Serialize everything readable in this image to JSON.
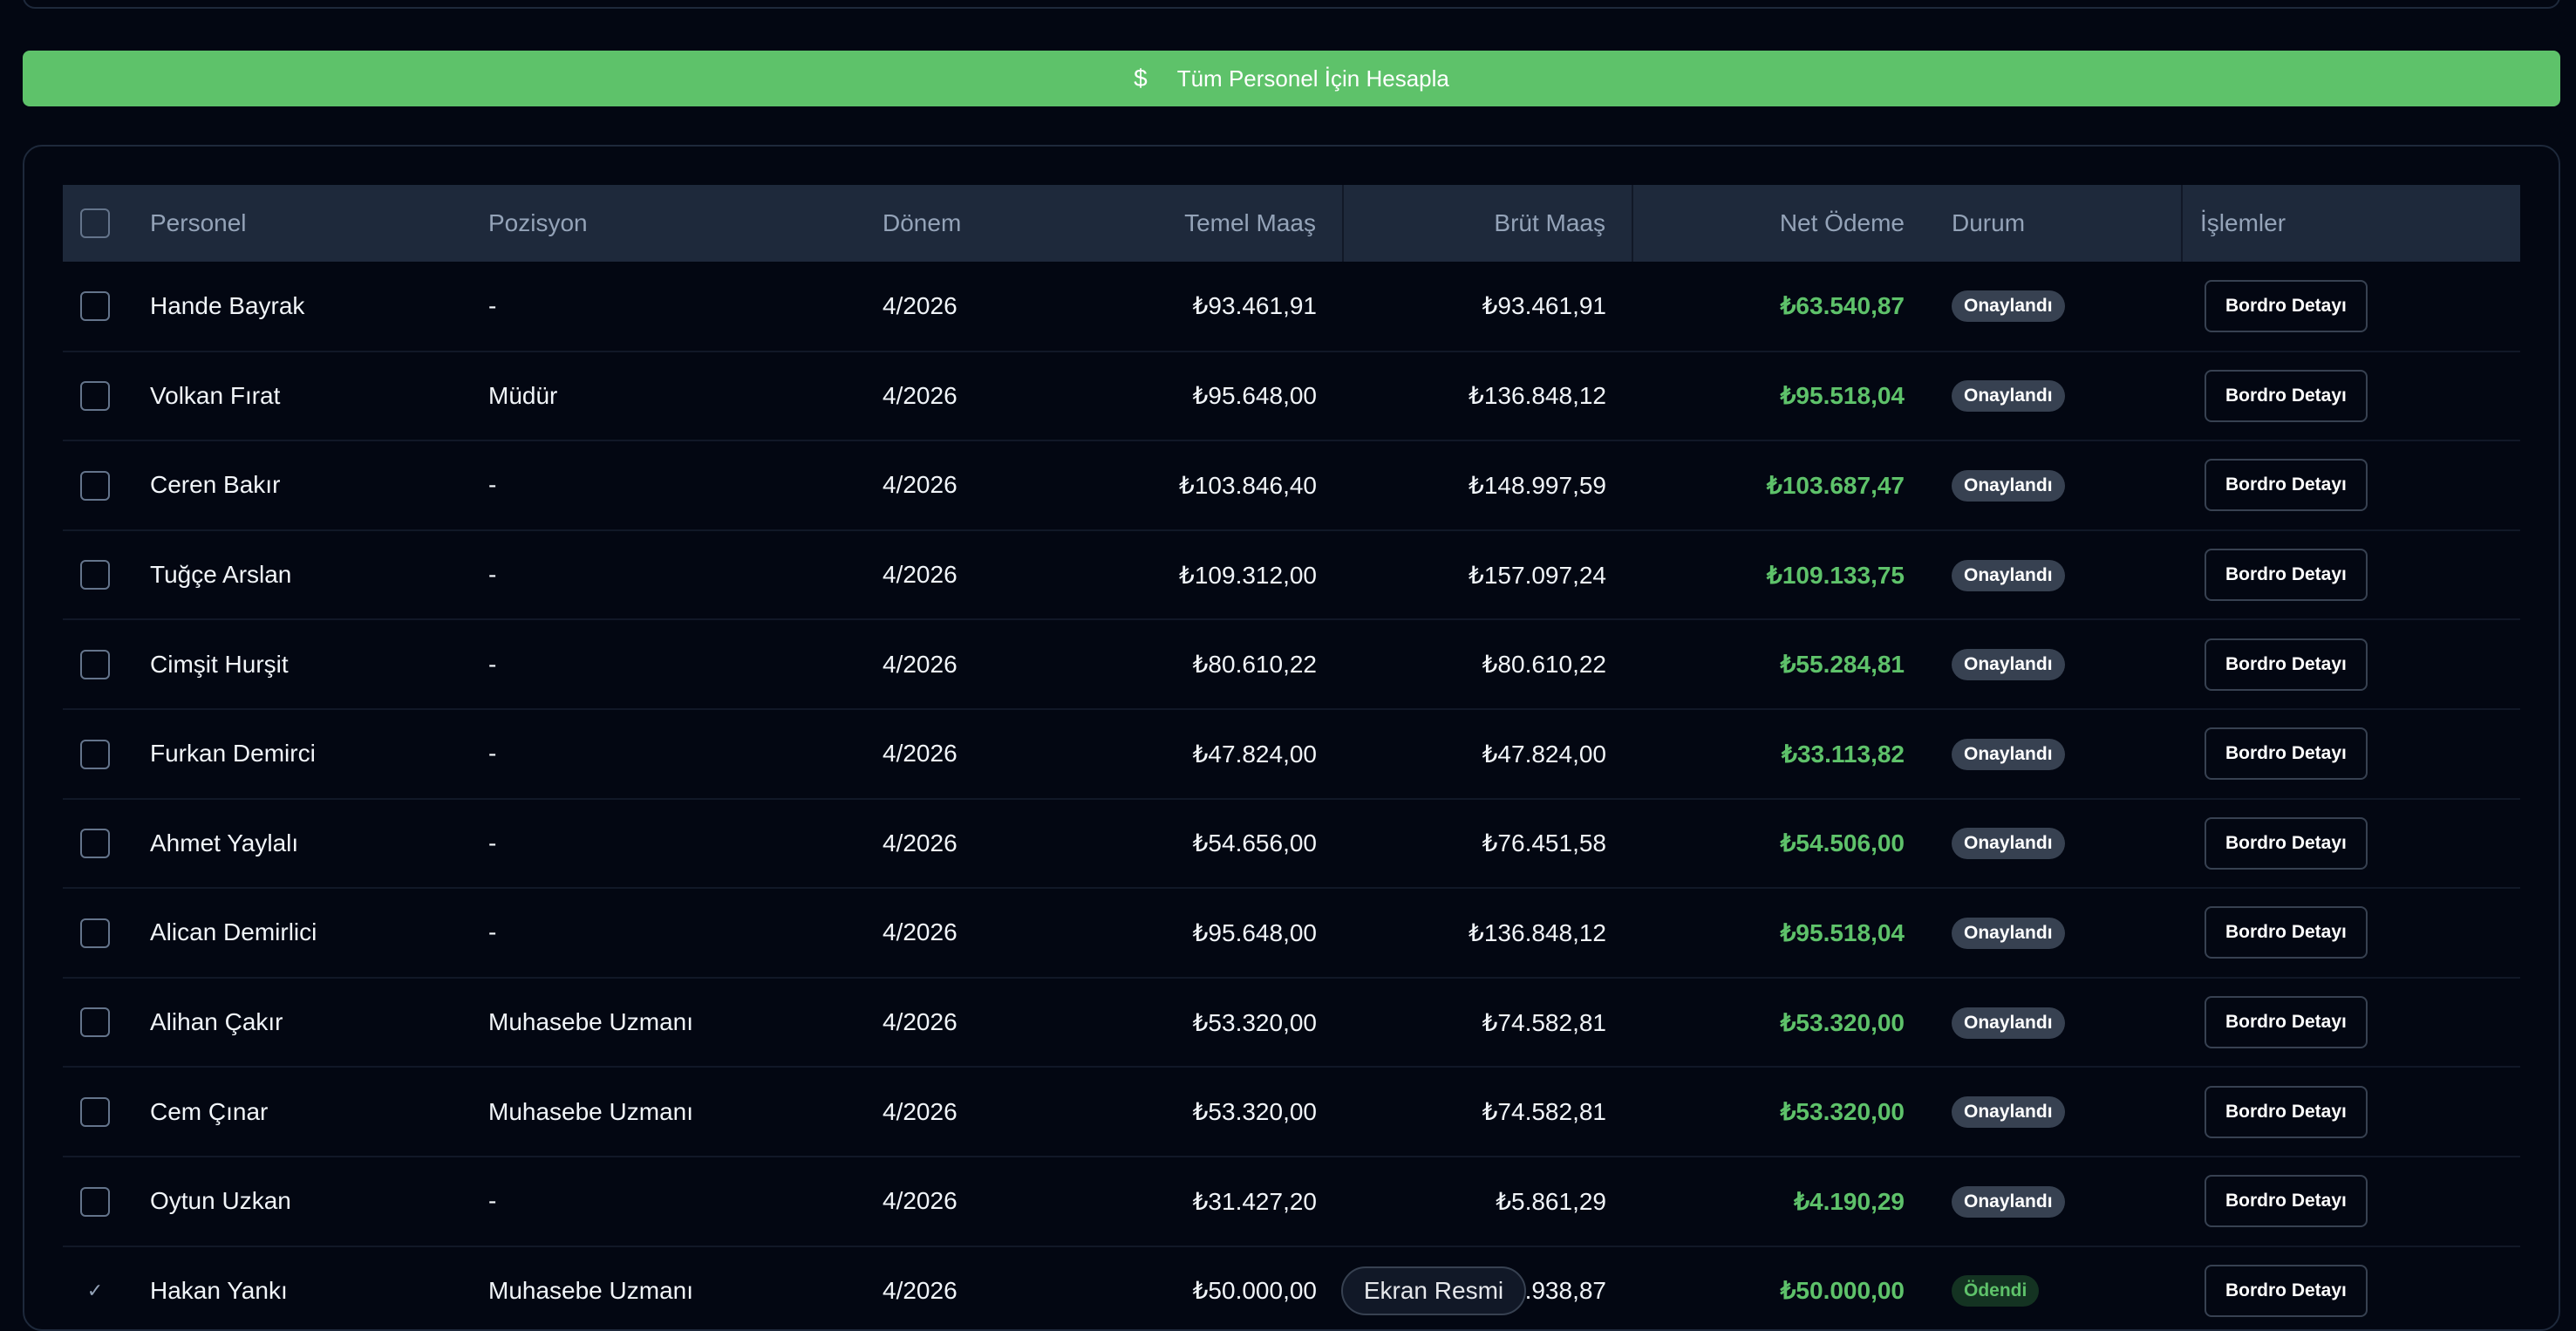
{
  "calc_button": {
    "label": "Tüm Personel İçin Hesapla",
    "icon": "dollar-icon"
  },
  "colors": {
    "accent_green": "#5ec26a",
    "background": "#030712",
    "header_bg": "#1e293b"
  },
  "table": {
    "headers": {
      "personnel": "Personel",
      "position": "Pozisyon",
      "period": "Dönem",
      "base_salary": "Temel Maaş",
      "gross_salary": "Brüt Maaş",
      "net_payment": "Net Ödeme",
      "status": "Durum",
      "actions": "İşlemler"
    },
    "rows": [
      {
        "name": "Hande Bayrak",
        "position": "-",
        "period": "4/2026",
        "base": "₺93.461,91",
        "gross": "₺93.461,91",
        "net": "₺63.540,87",
        "status": "Onaylandı",
        "action": "Bordro Detayı",
        "checked": false
      },
      {
        "name": "Volkan Fırat",
        "position": "Müdür",
        "period": "4/2026",
        "base": "₺95.648,00",
        "gross": "₺136.848,12",
        "net": "₺95.518,04",
        "status": "Onaylandı",
        "action": "Bordro Detayı",
        "checked": false
      },
      {
        "name": "Ceren Bakır",
        "position": "-",
        "period": "4/2026",
        "base": "₺103.846,40",
        "gross": "₺148.997,59",
        "net": "₺103.687,47",
        "status": "Onaylandı",
        "action": "Bordro Detayı",
        "checked": false
      },
      {
        "name": "Tuğçe Arslan",
        "position": "-",
        "period": "4/2026",
        "base": "₺109.312,00",
        "gross": "₺157.097,24",
        "net": "₺109.133,75",
        "status": "Onaylandı",
        "action": "Bordro Detayı",
        "checked": false
      },
      {
        "name": "Cimşit Hurşit",
        "position": "-",
        "period": "4/2026",
        "base": "₺80.610,22",
        "gross": "₺80.610,22",
        "net": "₺55.284,81",
        "status": "Onaylandı",
        "action": "Bordro Detayı",
        "checked": false
      },
      {
        "name": "Furkan Demirci",
        "position": "-",
        "period": "4/2026",
        "base": "₺47.824,00",
        "gross": "₺47.824,00",
        "net": "₺33.113,82",
        "status": "Onaylandı",
        "action": "Bordro Detayı",
        "checked": false
      },
      {
        "name": "Ahmet Yaylalı",
        "position": "-",
        "period": "4/2026",
        "base": "₺54.656,00",
        "gross": "₺76.451,58",
        "net": "₺54.506,00",
        "status": "Onaylandı",
        "action": "Bordro Detayı",
        "checked": false
      },
      {
        "name": "Alican Demirlici",
        "position": "-",
        "period": "4/2026",
        "base": "₺95.648,00",
        "gross": "₺136.848,12",
        "net": "₺95.518,04",
        "status": "Onaylandı",
        "action": "Bordro Detayı",
        "checked": false
      },
      {
        "name": "Alihan Çakır",
        "position": "Muhasebe Uzmanı",
        "period": "4/2026",
        "base": "₺53.320,00",
        "gross": "₺74.582,81",
        "net": "₺53.320,00",
        "status": "Onaylandı",
        "action": "Bordro Detayı",
        "checked": false
      },
      {
        "name": "Cem Çınar",
        "position": "Muhasebe Uzmanı",
        "period": "4/2026",
        "base": "₺53.320,00",
        "gross": "₺74.582,81",
        "net": "₺53.320,00",
        "status": "Onaylandı",
        "action": "Bordro Detayı",
        "checked": false
      },
      {
        "name": "Oytun Uzkan",
        "position": "-",
        "period": "4/2026",
        "base": "₺31.427,20",
        "gross": "₺5.861,29",
        "net": "₺4.190,29",
        "status": "Onaylandı",
        "action": "Bordro Detayı",
        "checked": false
      },
      {
        "name": "Hakan Yankı",
        "position": "Muhasebe Uzmanı",
        "period": "4/2026",
        "base": "₺50.000,00",
        "gross": "9.938,87",
        "net": "₺50.000,00",
        "status": "Ödendi",
        "action": "Bordro Detayı",
        "checked": true
      }
    ]
  },
  "toast": {
    "label": "Ekran Resmi"
  }
}
